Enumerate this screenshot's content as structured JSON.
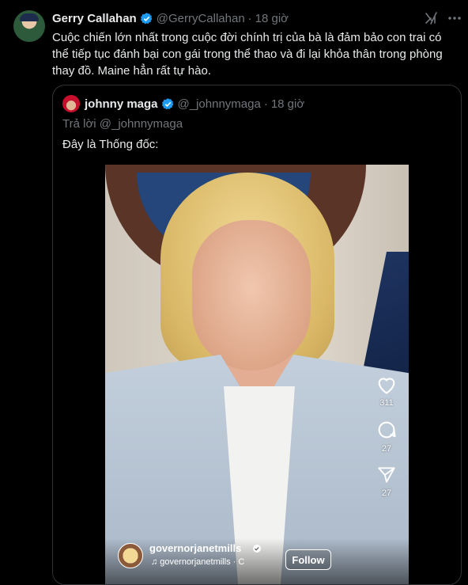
{
  "tweet": {
    "author_name": "Gerry Callahan",
    "author_handle": "@GerryCallahan",
    "separator": "·",
    "time": "18 giờ",
    "text": "Cuộc chiến lớn nhất trong cuộc đời chính trị của bà là đảm bảo con trai có thể tiếp tục đánh bại con gái trong thể thao và đi lại khỏa thân trong phòng thay đồ. Maine hẳn rất tự hào."
  },
  "quoted": {
    "author_name": "johnny maga",
    "author_handle": "@_johnnymaga",
    "separator": "·",
    "time": "18 giờ",
    "reply_to": "Trả lời @_johnnymaga",
    "text": "Đây là Thống đốc:"
  },
  "video": {
    "likes": "311",
    "comments": "27",
    "shares": "27",
    "ig_username": "governorjanetmills",
    "music_text": "♫ governorjanetmills · C",
    "follow_label": "Follow"
  },
  "colors": {
    "background": "#000000",
    "text": "#e7e9ea",
    "muted": "#71767b",
    "verified": "#1d9bf0",
    "border": "#2f3336"
  },
  "icons": [
    "verified-badge-icon",
    "grok-icon",
    "more-icon",
    "heart-icon",
    "comment-icon",
    "share-icon",
    "music-icon"
  ]
}
